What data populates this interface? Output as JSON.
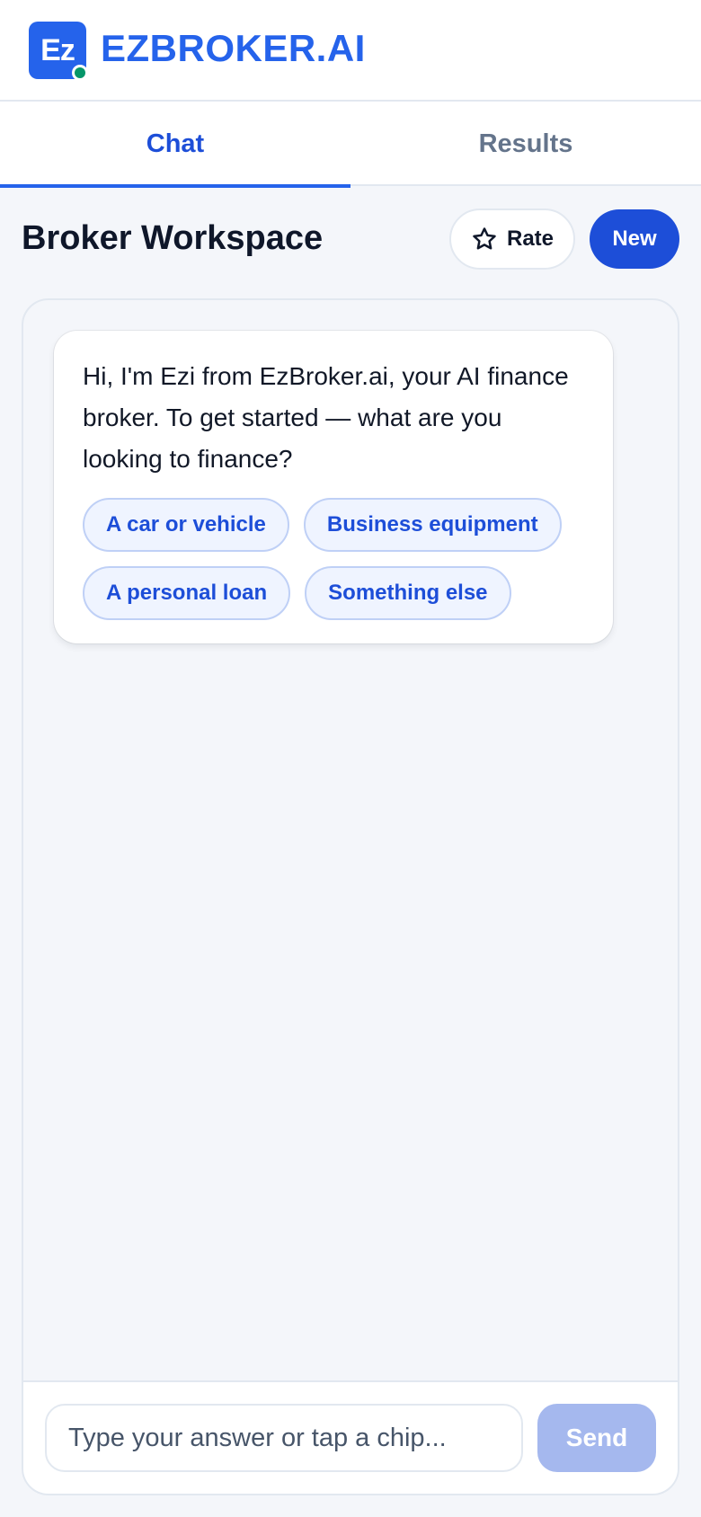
{
  "header": {
    "logo_text": "Ez",
    "brand": "EZBROKER.AI"
  },
  "tabs": [
    {
      "label": "Chat",
      "active": true
    },
    {
      "label": "Results",
      "active": false
    }
  ],
  "workspace": {
    "title": "Broker Workspace",
    "rate_label": "Rate",
    "new_label": "New"
  },
  "chat": {
    "message": "Hi, I'm Ezi from EzBroker.ai, your AI finance broker. To get started — what are you looking to finance?",
    "chips": [
      "A car or vehicle",
      "Business equipment",
      "A personal loan",
      "Something else"
    ]
  },
  "composer": {
    "placeholder": "Type your answer or tap a chip...",
    "value": "",
    "send_label": "Send"
  },
  "colors": {
    "brand": "#2563eb",
    "primary": "#1d4ed8",
    "status_dot": "#059669",
    "send_disabled": "#a5b8ee"
  },
  "icons": {
    "rate": "star-icon",
    "status": "online-dot-icon"
  }
}
